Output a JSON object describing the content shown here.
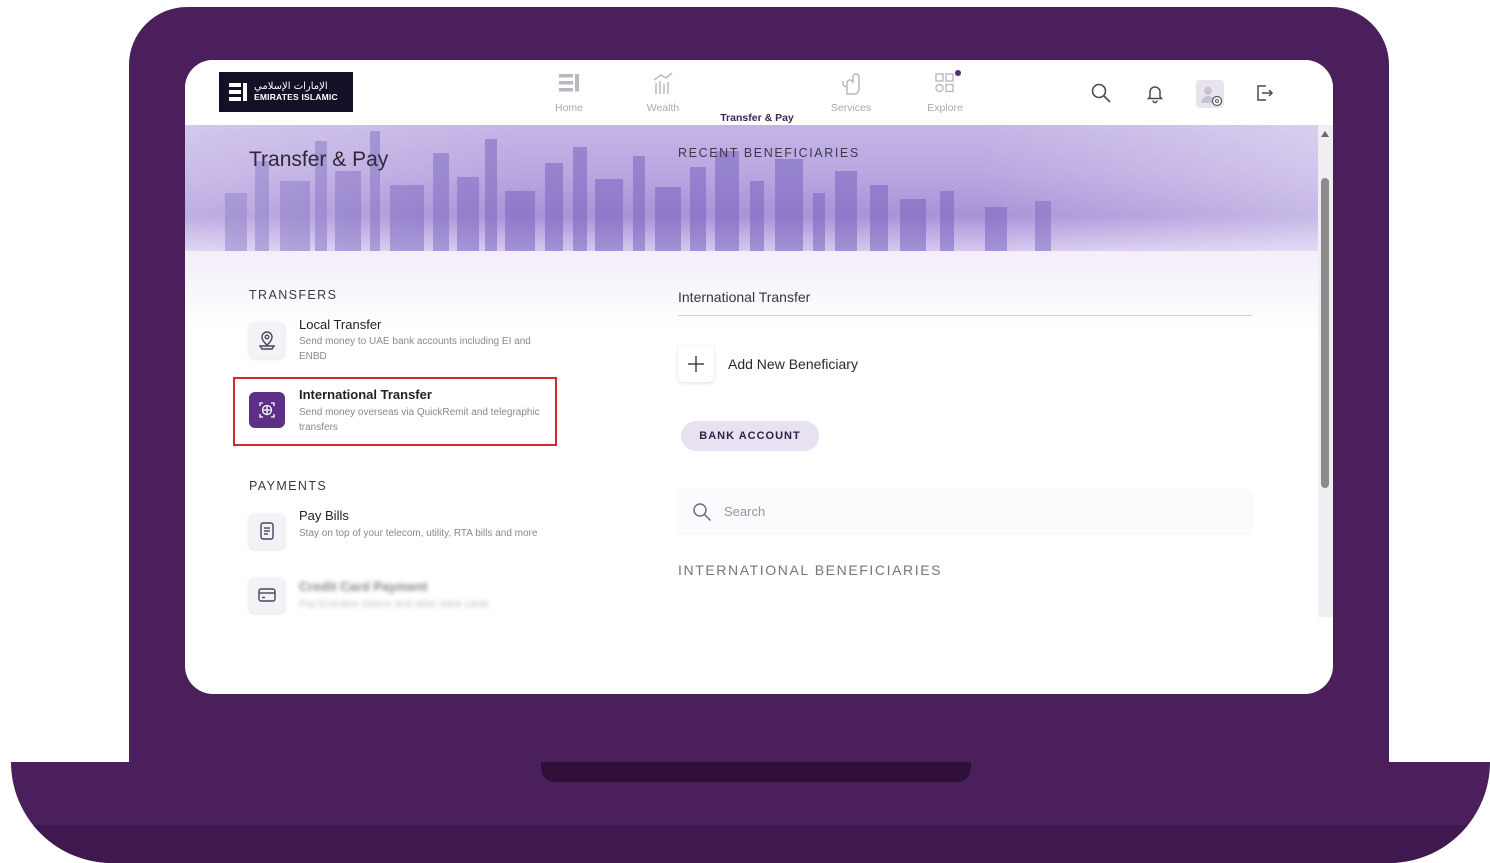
{
  "brand": {
    "logo_arabic": "الإمارات الإسلامي",
    "logo_english": "EMIRATES ISLAMIC"
  },
  "nav": {
    "items": [
      {
        "label": "Home",
        "icon": "home-icon"
      },
      {
        "label": "Wealth",
        "icon": "wealth-chart-icon"
      },
      {
        "label": "Transfer & Pay",
        "icon": "transfer-icon",
        "active": true
      },
      {
        "label": "Services",
        "icon": "services-hand-icon"
      },
      {
        "label": "Explore",
        "icon": "explore-grid-icon"
      }
    ],
    "toolbar_icons": [
      "search-icon",
      "bell-icon",
      "profile-settings-icon",
      "logout-icon"
    ]
  },
  "page": {
    "title": "Transfer & Pay",
    "recent_beneficiaries": "RECENT BENEFICIARIES"
  },
  "transfers": {
    "heading": "TRANSFERS",
    "items": [
      {
        "title": "Local Transfer",
        "desc": "Send money to UAE bank accounts including EI and ENBD",
        "icon": "local-transfer-icon"
      },
      {
        "title": "International Transfer",
        "desc": "Send money overseas via QuickRemit and telegraphic transfers",
        "icon": "international-transfer-icon",
        "selected": true
      }
    ]
  },
  "payments": {
    "heading": "PAYMENTS",
    "items": [
      {
        "title": "Pay Bills",
        "desc": "Stay on top of your telecom, utility, RTA bills and more",
        "icon": "bill-icon"
      },
      {
        "title": "Credit Card Payment",
        "desc": "Pay Emirates Islamic and other bank cards",
        "icon": "credit-card-icon"
      }
    ]
  },
  "international": {
    "label": "International Transfer",
    "add_beneficiary": "Add New Beneficiary",
    "chip": "BANK ACCOUNT",
    "search_placeholder": "Search",
    "beneficiaries_heading": "INTERNATIONAL BENEFICIARIES"
  },
  "colors": {
    "laptop_frame": "#4a1f5c",
    "brand_purple": "#5d2f86",
    "highlight_red": "#d02a2f"
  }
}
